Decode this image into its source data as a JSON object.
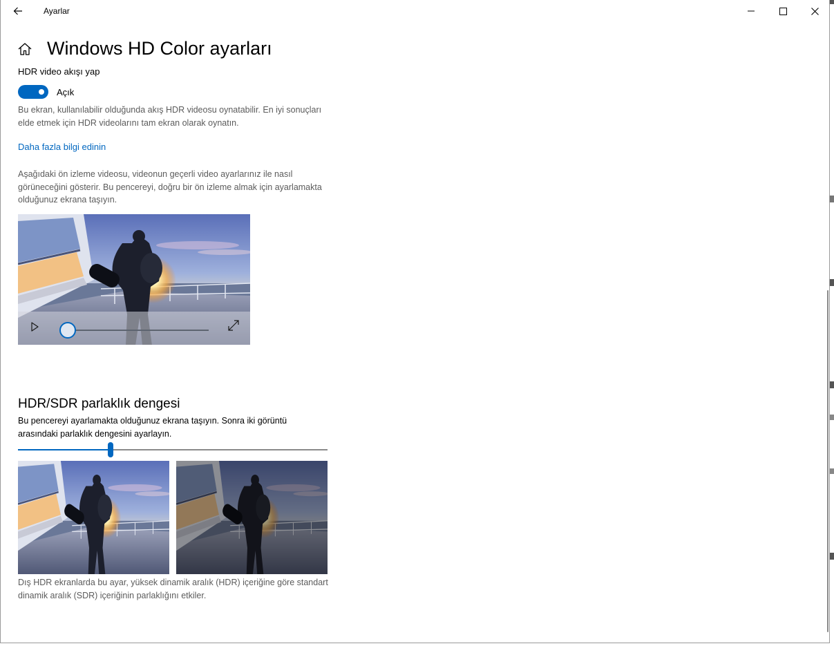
{
  "window": {
    "title": "Ayarlar"
  },
  "page": {
    "title": "Windows HD Color ayarları"
  },
  "hdr_streaming": {
    "heading": "HDR video akışı yap",
    "toggle_label": "Açık",
    "toggle_on": true,
    "description": "Bu ekran, kullanılabilir olduğunda akış HDR videosu oynatabilir. En iyi sonuçları elde etmek için HDR videolarını tam ekran olarak oynatın.",
    "learn_more": "Daha fazla bilgi edinin",
    "preview_description": "Aşağıdaki ön izleme videosu, videonun geçerli video ayarlarınız ile nasıl görüneceğini gösterir. Bu pencereyi, doğru bir ön izleme almak için ayarlamakta olduğunuz ekrana taşıyın."
  },
  "video_player": {
    "progress": 0.0
  },
  "brightness_balance": {
    "heading": "HDR/SDR parlaklık dengesi",
    "instruction": "Bu pencereyi ayarlamakta olduğunuz ekrana taşıyın. Sonra iki görüntü arasındaki parlaklık dengesini ayarlayın.",
    "slider_value": 0.3,
    "footer": "Dış HDR ekranlarda bu ayar, yüksek dinamik aralık (HDR) içeriğine göre standart dinamik aralık (SDR) içeriğinin parlaklığını etkiler."
  },
  "colors": {
    "accent": "#0067c0",
    "link": "#0067c0",
    "description_text": "#5b5b5b"
  },
  "icons": [
    "back-arrow-icon",
    "minimize-icon",
    "maximize-icon",
    "close-icon",
    "home-icon",
    "play-icon",
    "fullscreen-icon"
  ]
}
